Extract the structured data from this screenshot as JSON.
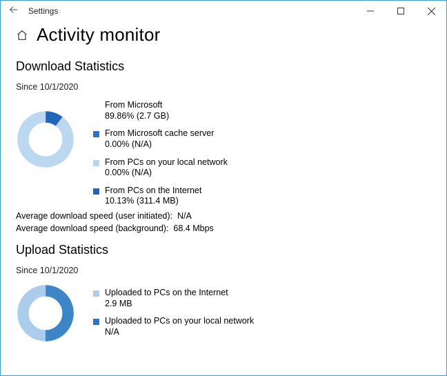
{
  "window": {
    "title": "Settings"
  },
  "page": {
    "title": "Activity monitor"
  },
  "download": {
    "heading": "Download Statistics",
    "since": "Since 10/1/2020",
    "legend": [
      {
        "label": "From Microsoft",
        "value": "89.86%  (2.7 GB)",
        "color": "#b8d6ee"
      },
      {
        "label": "From Microsoft cache server",
        "value": "0.00%  (N/A)",
        "color": "#2c72c7"
      },
      {
        "label": "From PCs on your local network",
        "value": "0.00%  (N/A)",
        "color": "#b8d6ee"
      },
      {
        "label": "From PCs on the Internet",
        "value": "10.13%  (311.4 MB)",
        "color": "#1f65b8"
      }
    ],
    "avg_user_label": "Average download speed (user initiated):",
    "avg_user_value": "N/A",
    "avg_bg_label": "Average download speed (background):",
    "avg_bg_value": "68.4 Mbps"
  },
  "upload": {
    "heading": "Upload Statistics",
    "since": "Since 10/1/2020",
    "legend": [
      {
        "label": "Uploaded to PCs on the Internet",
        "value": "2.9 MB",
        "color": "#a9cdea"
      },
      {
        "label": "Uploaded to PCs on your local network",
        "value": "N/A",
        "color": "#2c72c7"
      }
    ]
  },
  "chart_data": [
    {
      "type": "pie",
      "title": "Download sources",
      "series": [
        {
          "name": "From Microsoft",
          "value": 89.86,
          "size": "2.7 GB"
        },
        {
          "name": "From Microsoft cache server",
          "value": 0.0,
          "size": "N/A"
        },
        {
          "name": "From PCs on your local network",
          "value": 0.0,
          "size": "N/A"
        },
        {
          "name": "From PCs on the Internet",
          "value": 10.13,
          "size": "311.4 MB"
        }
      ],
      "unit": "percent"
    },
    {
      "type": "pie",
      "title": "Upload destinations",
      "series": [
        {
          "name": "Uploaded to PCs on the Internet",
          "size": "2.9 MB"
        },
        {
          "name": "Uploaded to PCs on your local network",
          "size": "N/A"
        }
      ]
    }
  ]
}
